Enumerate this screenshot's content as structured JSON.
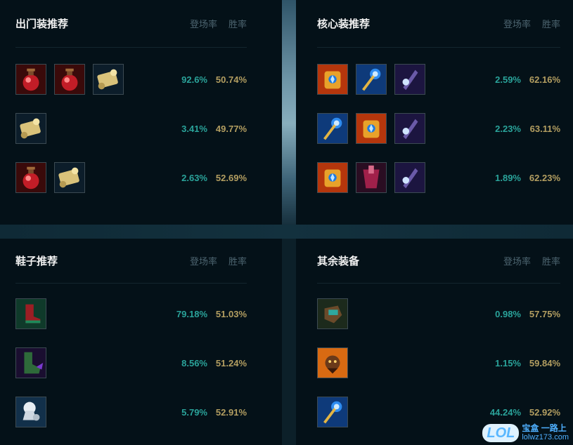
{
  "columns": {
    "pick": "登场率",
    "win": "胜率"
  },
  "panels": {
    "starter": {
      "title": "出门装推荐",
      "rows": [
        {
          "icons": [
            "health-potion-icon",
            "health-potion-icon",
            "scroll-icon"
          ],
          "pick": "92.6%",
          "win": "50.74%"
        },
        {
          "icons": [
            "scroll-icon"
          ],
          "pick": "3.41%",
          "win": "49.77%"
        },
        {
          "icons": [
            "health-potion-icon",
            "scroll-icon"
          ],
          "pick": "2.63%",
          "win": "52.69%"
        }
      ]
    },
    "core": {
      "title": "核心装推荐",
      "rows": [
        {
          "icons": [
            "crown-icon",
            "staff-icon",
            "dark-blade-icon"
          ],
          "pick": "2.59%",
          "win": "62.16%"
        },
        {
          "icons": [
            "staff-icon",
            "crown-icon",
            "dark-blade-icon"
          ],
          "pick": "2.23%",
          "win": "63.11%"
        },
        {
          "icons": [
            "crown-icon",
            "crimson-armor-icon",
            "dark-blade-icon"
          ],
          "pick": "1.89%",
          "win": "62.23%"
        }
      ]
    },
    "boots": {
      "title": "鞋子推荐",
      "rows": [
        {
          "icons": [
            "red-boots-icon"
          ],
          "pick": "79.18%",
          "win": "51.03%"
        },
        {
          "icons": [
            "green-boots-icon"
          ],
          "pick": "8.56%",
          "win": "51.24%"
        },
        {
          "icons": [
            "white-boots-icon"
          ],
          "pick": "5.79%",
          "win": "52.91%"
        }
      ]
    },
    "other": {
      "title": "其余装备",
      "rows": [
        {
          "icons": [
            "gauntlet-icon"
          ],
          "pick": "0.98%",
          "win": "57.75%"
        },
        {
          "icons": [
            "beast-icon"
          ],
          "pick": "1.15%",
          "win": "59.84%"
        },
        {
          "icons": [
            "staff-icon"
          ],
          "pick": "44.24%",
          "win": "52.92%"
        }
      ]
    }
  },
  "watermark": {
    "logo": "LOL",
    "top": "宝盒 一路上",
    "bottom": "lolwz173.com"
  }
}
